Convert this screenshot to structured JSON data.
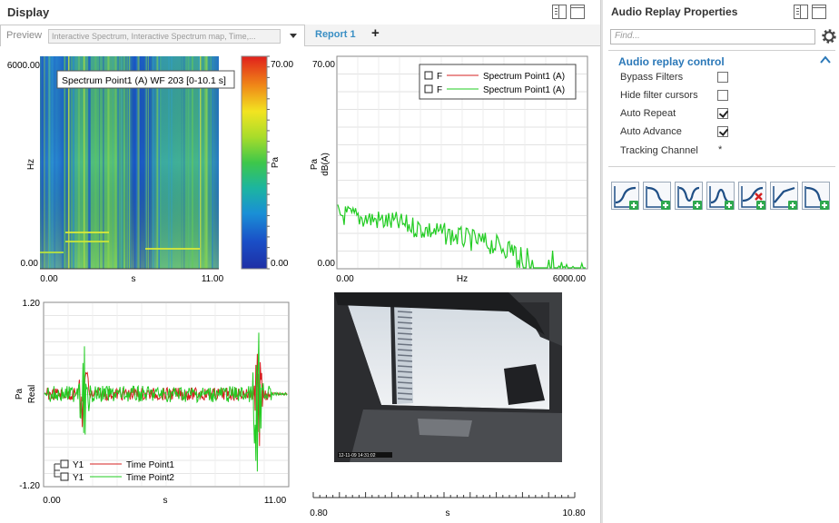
{
  "display": {
    "title": "Display",
    "tabs": {
      "preview_label": "Preview",
      "preview_combo": "Interactive Spectrum, Interactive Spectrum map, Time,...",
      "report_label": "Report 1",
      "add_label": "+"
    }
  },
  "spectrogram": {
    "tooltip": "Spectrum Point1 (A) WF 203 [0-10.1 s]",
    "y_label": "Hz",
    "y_top": "6000.00",
    "y_bottom": "0.00",
    "x_left": "0.00",
    "x_mid": "s",
    "x_right": "11.00",
    "colorbar_unit": "Pa",
    "colorbar_top": "70.00",
    "colorbar_bottom": "0.00"
  },
  "spectrum": {
    "y_label1": "Pa",
    "y_label2": "dB(A)",
    "y_top": "70.00",
    "y_bottom": "0.00",
    "x_left": "0.00",
    "x_mid": "Hz",
    "x_right": "6000.00",
    "legend": [
      {
        "tag": "F",
        "name": "Spectrum Point1 (A)",
        "color": "#d42020"
      },
      {
        "tag": "F",
        "name": "Spectrum Point1 (A)",
        "color": "#22cc22"
      }
    ]
  },
  "timeplot": {
    "y_label1": "Pa",
    "y_label2": "Real",
    "y_top": "1.20",
    "y_bottom": "-1.20",
    "x_left": "0.00",
    "x_mid": "s",
    "x_right": "11.00",
    "legend": [
      {
        "tag": "Y1",
        "name": "Time Point1",
        "color": "#d42020"
      },
      {
        "tag": "Y1",
        "name": "Time Point2",
        "color": "#22cc22"
      }
    ]
  },
  "video": {
    "timestamp": "12-11-09 14:31:02"
  },
  "bottom_axis": {
    "x_left": "0.80",
    "x_mid": "s",
    "x_right": "10.80"
  },
  "props": {
    "title": "Audio Replay Properties",
    "find_placeholder": "Find...",
    "section_title": "Audio replay control",
    "rows": [
      {
        "label": "Bypass Filters",
        "checked": false
      },
      {
        "label": "Hide filter cursors",
        "checked": false
      },
      {
        "label": "Auto Repeat",
        "checked": true
      },
      {
        "label": "Auto Advance",
        "checked": true
      },
      {
        "label": "Tracking Channel",
        "value": "*"
      }
    ],
    "tools": [
      "add-filter-lowpass-icon",
      "add-filter-highpass-icon",
      "add-filter-bandstop-icon",
      "add-filter-bandpass-icon",
      "remove-filter-icon",
      "add-filter-slope-icon",
      "add-filter-notch-icon"
    ]
  },
  "colors": {
    "accent": "#2b78b8",
    "series_red": "#d42020",
    "series_green": "#22cc22"
  }
}
